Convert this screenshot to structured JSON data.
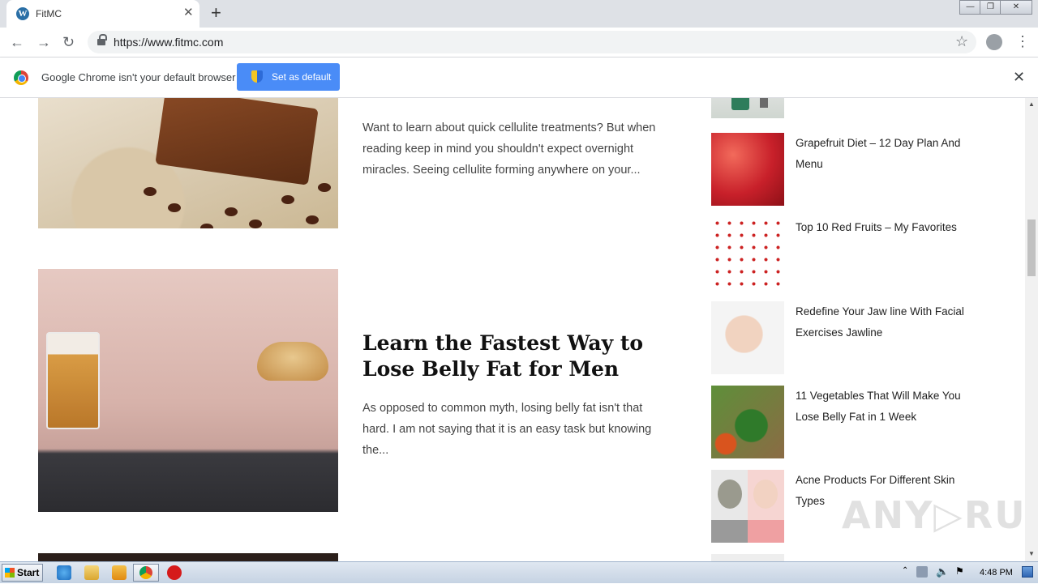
{
  "browser": {
    "tab_title": "FitMC",
    "tab_close": "✕",
    "new_tab": "+",
    "url": "https://www.fitmc.com",
    "infobar_text": "Google Chrome isn't your default browser",
    "infobar_button": "Set as default",
    "infobar_close": "✕"
  },
  "posts": [
    {
      "excerpt": "Want to learn about quick cellulite treatments? But when reading keep in mind you shouldn't expect overnight miracles. Seeing cellulite forming anywhere on your..."
    },
    {
      "title": "Learn the Fastest Way to Lose Belly Fat for Men",
      "excerpt": "As opposed to common myth, losing belly fat isn't that hard. I am not saying that it is an easy task but knowing the..."
    }
  ],
  "sidebar": {
    "items": [
      {
        "title": "Grapefruit Diet – 12 Day Plan And Menu"
      },
      {
        "title": "Top 10 Red Fruits – My Favorites"
      },
      {
        "title": "Redefine Your Jaw line With Facial Exercises Jawline"
      },
      {
        "title": "11 Vegetables That Will Make You Lose Belly Fat in 1 Week"
      },
      {
        "title": "Acne Products For Different Skin Types"
      }
    ]
  },
  "watermark": "ANY▷RUN",
  "taskbar": {
    "start_label": "Start",
    "clock": "4:48 PM"
  }
}
